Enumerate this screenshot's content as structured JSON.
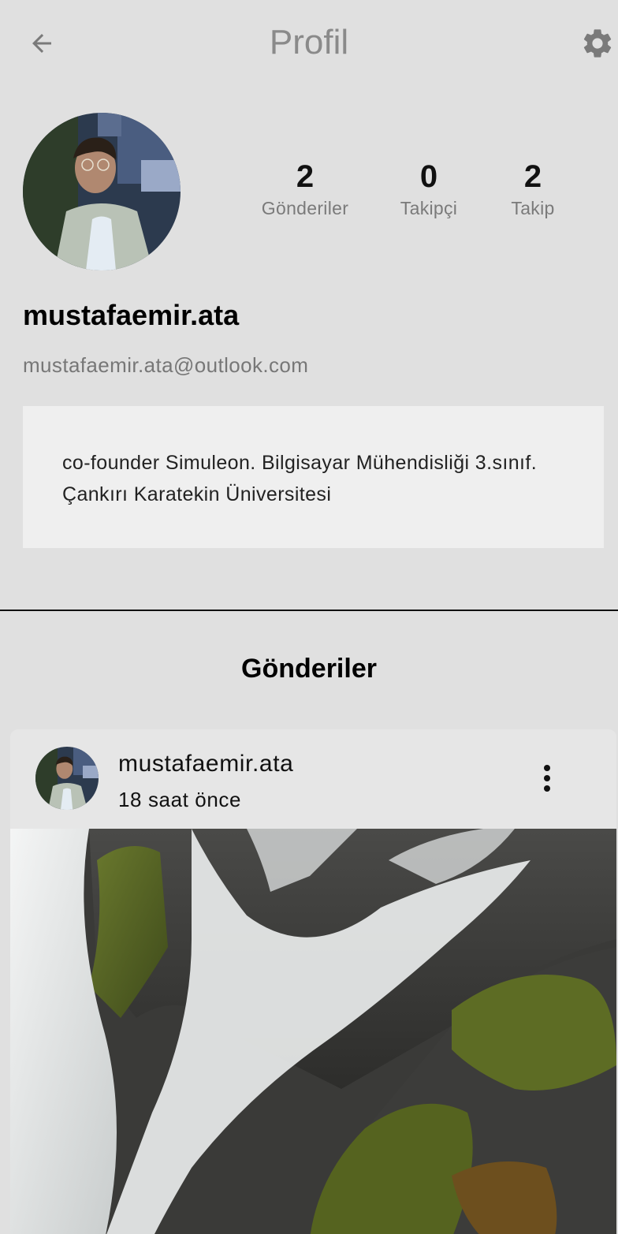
{
  "appbar": {
    "title": "Profil",
    "back_icon": "arrow-left-icon",
    "settings_icon": "gear-icon"
  },
  "profile": {
    "username": "mustafaemir.ata",
    "email": "mustafaemir.ata@outlook.com",
    "bio": "co-founder Simuleon. Bilgisayar Mühendisliği 3.sınıf. Çankırı Karatekin Üniversitesi",
    "stats": {
      "posts": {
        "value": "2",
        "label": "Gönderiler"
      },
      "followers": {
        "value": "0",
        "label": "Takipçi"
      },
      "following": {
        "value": "2",
        "label": "Takip"
      }
    }
  },
  "posts_section": {
    "title": "Gönderiler",
    "posts": [
      {
        "author": "mustafaemir.ata",
        "time": "18 saat önce",
        "menu_icon": "more-vertical-icon"
      }
    ]
  },
  "colors": {
    "background": "#e0e0e0",
    "bio_box": "#efefef",
    "title_gray": "#8a8a8a",
    "icon_gray": "#7a7a7a"
  }
}
